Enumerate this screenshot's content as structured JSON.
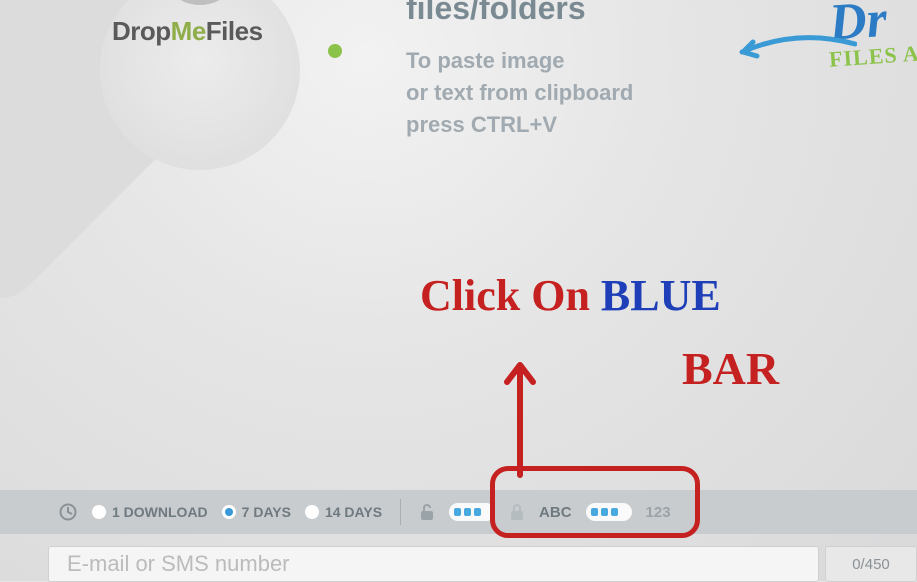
{
  "logo": {
    "drop": "Drop",
    "me": "Me",
    "files": "Files"
  },
  "instructions": {
    "title": "files/folders",
    "line1": "To paste image",
    "line2": "or text from clipboard",
    "line3": "press CTRL+V"
  },
  "rightwriting": {
    "big": "Dr",
    "small": "FILES AN"
  },
  "annotation": {
    "click_on": "Click On",
    "blue": "BLUE",
    "bar": "BAR"
  },
  "options": {
    "opt1": "1 DOWNLOAD",
    "opt2": "7 DAYS",
    "opt3": "14 DAYS",
    "abc": "ABC",
    "num": "123"
  },
  "input": {
    "placeholder": "E-mail or SMS number",
    "counter": "0/450"
  }
}
